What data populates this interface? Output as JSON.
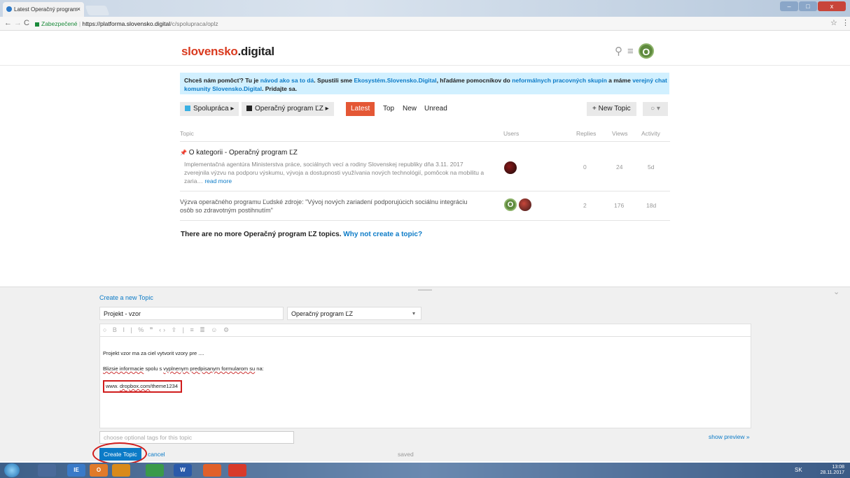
{
  "browser": {
    "tab_title": "Latest Operačný program",
    "tab_close": "×",
    "secure_label": "Zabezpečené",
    "url_host": "https://platforma.slovensko.digital",
    "url_path": "/c/spolupraca/oplz",
    "back": "←",
    "forward": "→",
    "reload": "C",
    "star": "☆",
    "menu": "⋮"
  },
  "site": {
    "logo_main": "slovensko",
    "logo_rest": ".digital",
    "avatar_letter": "O",
    "search_icon": "⚲",
    "menu_icon": "≡"
  },
  "banner": {
    "t1": "Chceš nám pomôcť? Tu je ",
    "l1": "návod ako sa to dá",
    "t2": ". Spustili sme ",
    "l2": "Ekosystém.Slovensko.Digital",
    "t3": ", hľadáme pomocníkov do ",
    "l3": "neformálnych pracovných skupín",
    "t4": " a máme ",
    "l4": "verejný chat komunity Slovensko.Digital",
    "t5": ". Pridajte sa."
  },
  "nav": {
    "crumb1": "Spolupráca",
    "crumb2": "Operačný program ĽZ",
    "crumb_arrow": "▸",
    "crumb1_color": "#3ab0e2",
    "crumb2_color": "#222222",
    "latest": "Latest",
    "top": "Top",
    "new": "New",
    "unread": "Unread",
    "new_topic": "New Topic",
    "new_topic_icon": "+",
    "notif": "○ ▾"
  },
  "table": {
    "headers": {
      "topic": "Topic",
      "users": "Users",
      "replies": "Replies",
      "views": "Views",
      "activity": "Activity"
    },
    "rows": [
      {
        "pin": "📌",
        "title": "O kategorii - Operačný program ĽZ",
        "excerpt": "Implementačná agentúra Ministerstva práce, sociálnych vecí a rodiny Slovenskej republiky dňa 3.11. 2017 zverejnila výzvu na podporu výskumu, vývoja a dostupnosti využívania nových technológií, pomôcok na mobilitu a zaria…",
        "read_more": "read more",
        "replies": "0",
        "views": "24",
        "activity": "5d"
      },
      {
        "title": "Výzva operačného programu Ľudské zdroje: \"Vývoj nových zariadení podporujúcich sociálnu integráciu osôb so zdravotným postihnutím\"",
        "user1_letter": "O",
        "replies": "2",
        "views": "176",
        "activity": "18d"
      }
    ]
  },
  "nomore": {
    "text": "There are no more Operačný program ĽZ topics. ",
    "link": "Why not create a topic?"
  },
  "composer": {
    "heading": "Create a new Topic",
    "title_value": "Projekt - vzor",
    "category": "Operačný program ĽZ",
    "category_caret": "▾",
    "toolbar": "○ B I | % ❞ ‹› ⇪ | ≡ ≣ ☺ ⚙",
    "line1": "Projekt vzor ma za ciel vytvorit vzory pre ....",
    "line2_a": "Blizsie informacie",
    "line2_b": " spolu s ",
    "line2_c": "vyplnenym predpisanym formularom su",
    "line2_d": " na:",
    "line3_a": "www. ",
    "line3_b": "dropbox.com",
    "line3_c": "/theme1234",
    "tags_placeholder": "choose optional tags for this topic",
    "show_preview": "show preview »",
    "create_button": "Create Topic",
    "cancel": "cancel",
    "saved": "saved",
    "collapse_icon": "⌄"
  },
  "taskbar": {
    "lang": "SK",
    "time": "13:08",
    "date": "28.11.2017",
    "apps": [
      "IE",
      "O",
      "W"
    ]
  }
}
